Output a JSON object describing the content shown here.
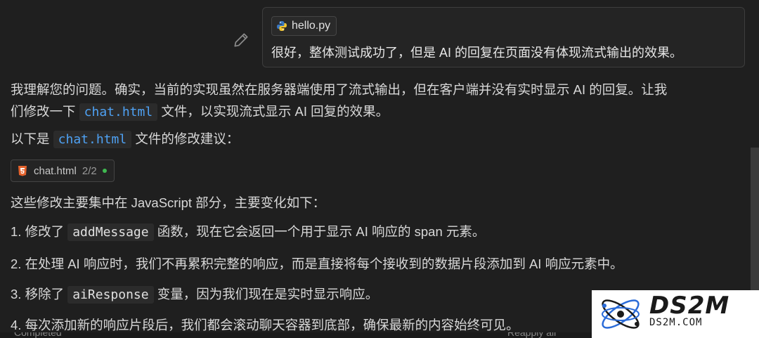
{
  "user_message": {
    "attachment_name": "hello.py",
    "text": "很好，整体测试成功了，但是 AI 的回复在页面没有体现流式输出的效果。"
  },
  "response": {
    "p1_line1": "我理解您的问题。确实，当前的实现虽然在服务器端使用了流式输出，但在客户端并没有实时显示 AI 的回复。让我",
    "p1_line2_pre": "们修改一下",
    "p1_code": "chat.html",
    "p1_line2_post": "文件，以实现流式显示 AI 回复的效果。",
    "p2_pre": "以下是",
    "p2_code": "chat.html",
    "p2_post": "文件的修改建议：",
    "file_pill": {
      "name": "chat.html",
      "count": "2/2"
    },
    "p3": "这些修改主要集中在 JavaScript 部分，主要变化如下：",
    "item1_pre": "1. 修改了",
    "item1_code": "addMessage",
    "item1_post": "函数，现在它会返回一个用于显示 AI 响应的 span 元素。",
    "item2": "2. 在处理 AI 响应时，我们不再累积完整的响应，而是直接将每个接收到的数据片段添加到 AI 响应元素中。",
    "item3_pre": "3. 移除了",
    "item3_code": "aiResponse",
    "item3_post": "变量，因为我们现在是实时显示响应。",
    "item4": "4. 每次添加新的响应片段后，我们都会滚动聊天容器到底部，确保最新的内容始终可见。"
  },
  "status_bar": {
    "left": "Completed",
    "right": "Reapply all"
  },
  "watermark": {
    "title": "DS2M",
    "subtitle": "DS2M.COM"
  }
}
